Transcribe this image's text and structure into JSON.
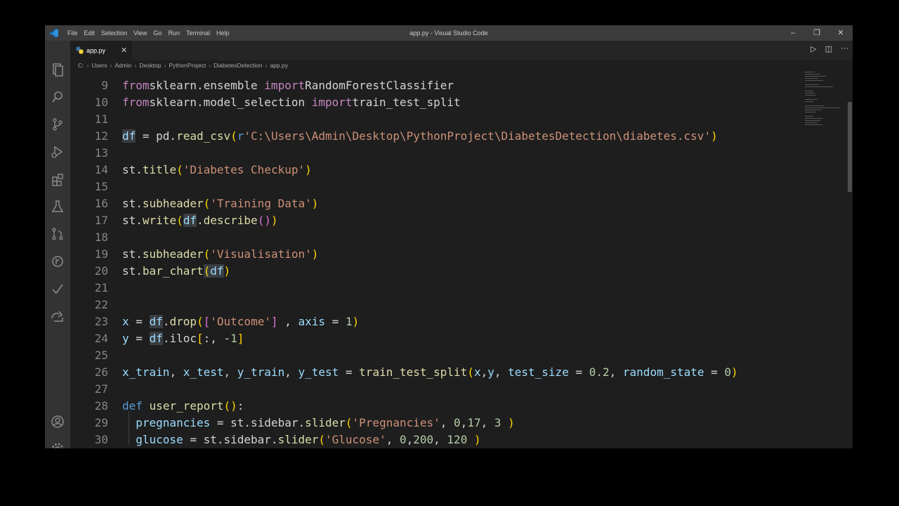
{
  "window": {
    "title": "app.py - Visual Studio Code",
    "menu": [
      "File",
      "Edit",
      "Selection",
      "View",
      "Go",
      "Run",
      "Terminal",
      "Help"
    ],
    "controls": {
      "minimize": "–",
      "restore": "❐",
      "close": "✕"
    }
  },
  "activity_bar": [
    "explorer-icon",
    "search-icon",
    "source-control-icon",
    "run-debug-icon",
    "extensions-icon",
    "testing-icon",
    "remote-icon",
    "git-graph-icon",
    "check-icon",
    "live-share-icon",
    "account-icon",
    "settings-gear-icon"
  ],
  "tab": {
    "label": "app.py",
    "close": "✕"
  },
  "editor_actions": {
    "run": "▷",
    "split": "◫",
    "more": "···"
  },
  "breadcrumb": [
    "C:",
    "Users",
    "Admin",
    "Desktop",
    "PythonProject",
    "DiabetesDetection",
    "app.py"
  ],
  "breadcrumb_sep": "›",
  "lines": [
    {
      "n": "9",
      "t": [
        [
          "kw",
          "from"
        ],
        [
          "",
          "sklearn.ensemble "
        ],
        [
          "kw",
          "import"
        ],
        [
          "",
          "RandomForestClassifier"
        ]
      ]
    },
    {
      "n": "10",
      "t": [
        [
          "kw",
          "from"
        ],
        [
          "",
          "sklearn.model_selection "
        ],
        [
          "kw",
          "import"
        ],
        [
          "",
          "train_test_split"
        ]
      ]
    },
    {
      "n": "11",
      "t": []
    },
    {
      "n": "12",
      "t": [
        [
          "var hl",
          "df"
        ],
        [
          "",
          " = pd."
        ],
        [
          "fn",
          "read_csv"
        ],
        [
          "br1",
          "("
        ],
        [
          "kw2",
          "r"
        ],
        [
          "str",
          "'C:\\Users\\Admin\\Desktop\\PythonProject\\DiabetesDetection\\diabetes.csv'"
        ],
        [
          "br1",
          ")"
        ]
      ]
    },
    {
      "n": "13",
      "t": []
    },
    {
      "n": "14",
      "t": [
        [
          "",
          "st."
        ],
        [
          "fn",
          "title"
        ],
        [
          "br1",
          "("
        ],
        [
          "str",
          "'Diabetes Checkup'"
        ],
        [
          "br1",
          ")"
        ]
      ]
    },
    {
      "n": "15",
      "t": []
    },
    {
      "n": "16",
      "t": [
        [
          "",
          "st."
        ],
        [
          "fn",
          "subheader"
        ],
        [
          "br1",
          "("
        ],
        [
          "str",
          "'Training Data'"
        ],
        [
          "br1",
          ")"
        ]
      ]
    },
    {
      "n": "17",
      "t": [
        [
          "",
          "st."
        ],
        [
          "fn",
          "write"
        ],
        [
          "br1",
          "("
        ],
        [
          "var hl",
          "df"
        ],
        [
          "",
          "."
        ],
        [
          "fn",
          "describe"
        ],
        [
          "br2",
          "()"
        ],
        [
          "br1",
          ")"
        ]
      ]
    },
    {
      "n": "18",
      "t": []
    },
    {
      "n": "19",
      "t": [
        [
          "",
          "st."
        ],
        [
          "fn",
          "subheader"
        ],
        [
          "br1",
          "("
        ],
        [
          "str",
          "'Visualisation'"
        ],
        [
          "br1",
          ")"
        ]
      ]
    },
    {
      "n": "20",
      "t": [
        [
          "",
          "st."
        ],
        [
          "fn",
          "bar_chart"
        ],
        [
          "br1 hl",
          "("
        ],
        [
          "var hl",
          "df"
        ],
        [
          "br1",
          ")"
        ]
      ]
    },
    {
      "n": "21",
      "t": []
    },
    {
      "n": "22",
      "t": []
    },
    {
      "n": "23",
      "t": [
        [
          "var",
          "x"
        ],
        [
          "",
          " = "
        ],
        [
          "var hl",
          "df"
        ],
        [
          "",
          "."
        ],
        [
          "fn",
          "drop"
        ],
        [
          "br1",
          "("
        ],
        [
          "br2",
          "["
        ],
        [
          "str",
          "'Outcome'"
        ],
        [
          "br2",
          "]"
        ],
        [
          "",
          " , "
        ],
        [
          "var",
          "axis"
        ],
        [
          "",
          " = "
        ],
        [
          "num",
          "1"
        ],
        [
          "br1",
          ")"
        ]
      ]
    },
    {
      "n": "24",
      "t": [
        [
          "var",
          "y"
        ],
        [
          "",
          " = "
        ],
        [
          "var hl",
          "df"
        ],
        [
          "",
          ".iloc"
        ],
        [
          "br1",
          "["
        ],
        [
          "",
          ":, -"
        ],
        [
          "num",
          "1"
        ],
        [
          "br1",
          "]"
        ]
      ]
    },
    {
      "n": "25",
      "t": []
    },
    {
      "n": "26",
      "t": [
        [
          "var",
          "x_train"
        ],
        [
          "",
          ", "
        ],
        [
          "var",
          "x_test"
        ],
        [
          "",
          ", "
        ],
        [
          "var",
          "y_train"
        ],
        [
          "",
          ", "
        ],
        [
          "var",
          "y_test"
        ],
        [
          "",
          " = "
        ],
        [
          "fn",
          "train_test_split"
        ],
        [
          "br1",
          "("
        ],
        [
          "var",
          "x"
        ],
        [
          "",
          ","
        ],
        [
          "var",
          "y"
        ],
        [
          "",
          ", "
        ],
        [
          "var",
          "test_size"
        ],
        [
          "",
          " = "
        ],
        [
          "num",
          "0.2"
        ],
        [
          "",
          ", "
        ],
        [
          "var",
          "random_state"
        ],
        [
          "",
          " = "
        ],
        [
          "num",
          "0"
        ],
        [
          "br1",
          ")"
        ]
      ]
    },
    {
      "n": "27",
      "t": []
    },
    {
      "n": "28",
      "t": [
        [
          "kw2",
          "def"
        ],
        [
          "",
          " "
        ],
        [
          "fn",
          "user_report"
        ],
        [
          "br1",
          "()"
        ],
        [
          "",
          ":"
        ]
      ]
    },
    {
      "n": "29",
      "t": [
        [
          "",
          "  "
        ],
        [
          "var",
          "pregnancies"
        ],
        [
          "",
          " = st.sidebar."
        ],
        [
          "fn",
          "slider"
        ],
        [
          "br1",
          "("
        ],
        [
          "str",
          "'Pregnancies'"
        ],
        [
          "",
          ", "
        ],
        [
          "num",
          "0"
        ],
        [
          "",
          ","
        ],
        [
          "num",
          "17"
        ],
        [
          "",
          ", "
        ],
        [
          "num",
          "3"
        ],
        [
          "",
          " "
        ],
        [
          "br1",
          ")"
        ]
      ]
    },
    {
      "n": "30",
      "t": [
        [
          "",
          "  "
        ],
        [
          "var",
          "glucose"
        ],
        [
          "",
          " = st.sidebar."
        ],
        [
          "fn",
          "slider"
        ],
        [
          "br1",
          "("
        ],
        [
          "str",
          "'Glucose'"
        ],
        [
          "",
          ", "
        ],
        [
          "num",
          "0"
        ],
        [
          "",
          ","
        ],
        [
          "num",
          "200"
        ],
        [
          "",
          ", "
        ],
        [
          "num",
          "120"
        ],
        [
          "",
          " "
        ],
        [
          "br1",
          ")"
        ]
      ]
    }
  ]
}
